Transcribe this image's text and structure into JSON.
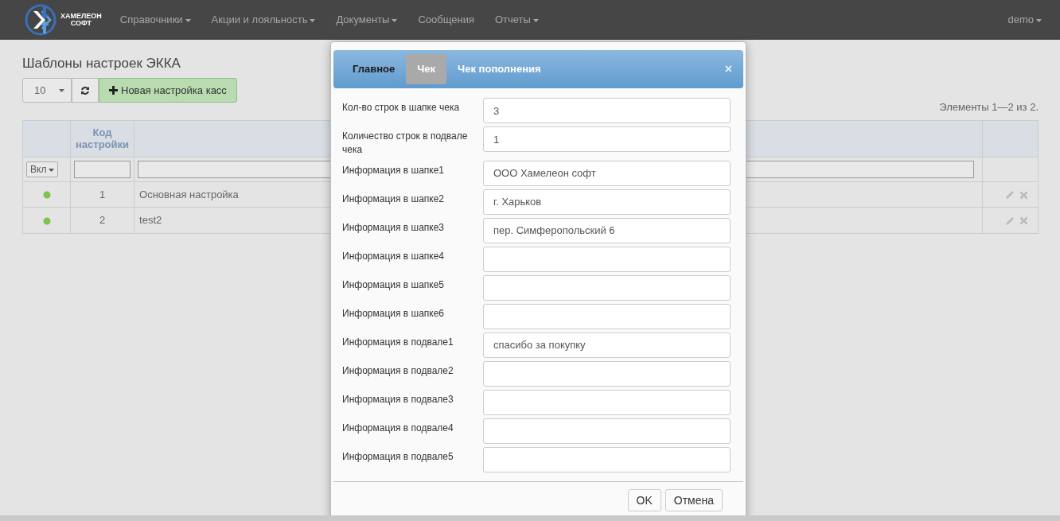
{
  "navbar": {
    "logo_text": [
      "ХАМЕЛЕОН",
      "СОФТ"
    ],
    "items": [
      {
        "label": "Справочники",
        "dropdown": true
      },
      {
        "label": "Акции и лояльность",
        "dropdown": true
      },
      {
        "label": "Документы",
        "dropdown": true
      },
      {
        "label": "Сообщения",
        "dropdown": false
      },
      {
        "label": "Отчеты",
        "dropdown": true
      }
    ],
    "user": {
      "label": "demo",
      "dropdown": true
    }
  },
  "page": {
    "title": "Шаблоны настроек ЭККА",
    "page_size": "10",
    "new_button": "Новая настройка касс",
    "summary": "Элементы 1—2 из 2.",
    "table": {
      "columns": [
        "",
        "Код настройки",
        "",
        ""
      ],
      "filter": {
        "status": "Вкл"
      },
      "rows": [
        {
          "active": true,
          "code": "1",
          "name": "Основная настройка"
        },
        {
          "active": true,
          "code": "2",
          "name": "test2"
        }
      ]
    }
  },
  "modal": {
    "tabs": [
      {
        "label": "Главное",
        "selected": true,
        "highlighted": false
      },
      {
        "label": "Чек",
        "selected": false,
        "highlighted": true
      },
      {
        "label": "Чек пополнения",
        "selected": false,
        "highlighted": false
      }
    ],
    "close": "×",
    "fields": [
      {
        "label": "Кол-во строк в шапке чека",
        "value": "3"
      },
      {
        "label": "Количество строк в подвале чека",
        "value": "1"
      },
      {
        "label": "Информация в шапке1",
        "value": "ООО Хамелеон софт"
      },
      {
        "label": "Информация в шапке2",
        "value": "г. Харьков"
      },
      {
        "label": "Информация в шапке3",
        "value": "пер. Симферопольский 6"
      },
      {
        "label": "Информация в шапке4"
      },
      {
        "label": "Информация в шапке5"
      },
      {
        "label": "Информация в шапке6"
      },
      {
        "label": "Информация в подвале1",
        "value": "спасибо за покупку"
      },
      {
        "label": "Информация в подвале2"
      },
      {
        "label": "Информация в подвале3"
      },
      {
        "label": "Информация в подвале4"
      },
      {
        "label": "Информация в подвале5"
      }
    ],
    "buttons": [
      "OK",
      "Отмена"
    ]
  }
}
